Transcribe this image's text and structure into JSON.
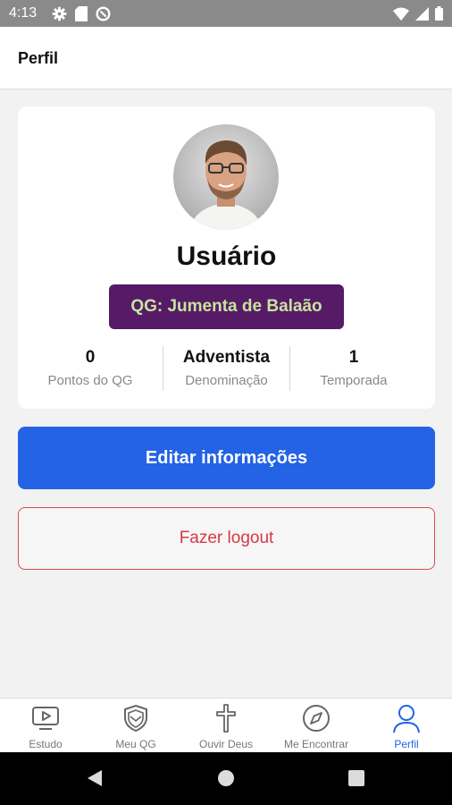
{
  "status_bar": {
    "time": "4:13",
    "icons": [
      "settings-icon",
      "sd-card-icon",
      "data-saver-icon",
      "wifi-icon",
      "signal-icon",
      "battery-icon"
    ]
  },
  "app_bar": {
    "title": "Perfil"
  },
  "profile": {
    "name": "Usuário",
    "qg_badge": "QG: Jumenta de Balaão",
    "stats": [
      {
        "value": "0",
        "label": "Pontos do QG"
      },
      {
        "value": "Adventista",
        "label": "Denominação"
      },
      {
        "value": "1",
        "label": "Temporada"
      }
    ]
  },
  "actions": {
    "edit_label": "Editar informações",
    "logout_label": "Fazer logout"
  },
  "bottom_nav": {
    "active": "Perfil",
    "items": [
      {
        "label": "Estudo",
        "icon": "video-player-icon"
      },
      {
        "label": "Meu QG",
        "icon": "shield-icon"
      },
      {
        "label": "Ouvir Deus",
        "icon": "cross-icon"
      },
      {
        "label": "Me Encontrar",
        "icon": "compass-icon"
      },
      {
        "label": "Perfil",
        "icon": "user-icon"
      }
    ]
  },
  "colors": {
    "primary": "#2462e6",
    "badge_bg": "#561a67",
    "badge_text": "#c7e39c",
    "logout": "#d63a44"
  }
}
